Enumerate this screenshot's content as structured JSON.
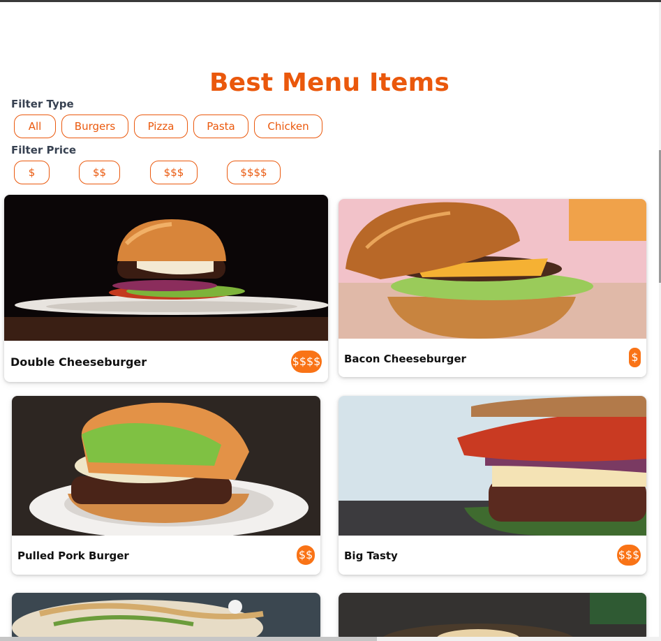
{
  "page": {
    "title": "Best Menu Items",
    "accent_color": "#ea580c",
    "badge_color": "#f97316"
  },
  "filters": {
    "type_label": "Filter Type",
    "type_options": [
      "All",
      "Burgers",
      "Pizza",
      "Pasta",
      "Chicken"
    ],
    "price_label": "Filter Price",
    "price_options": [
      "$",
      "$$",
      "$$$",
      "$$$$"
    ]
  },
  "items": [
    {
      "name": "Double Cheeseburger",
      "price": "$$$$",
      "image": "burger-on-plate-dark"
    },
    {
      "name": "Bacon Cheeseburger",
      "price": "$",
      "image": "cheeseburger-closeup"
    },
    {
      "name": "Pulled Pork Burger",
      "price": "$$",
      "image": "burger-with-lettuce"
    },
    {
      "name": "Big Tasty",
      "price": "$$$",
      "image": "burger-with-bacon-tomato"
    },
    {
      "name": "",
      "price": "",
      "image": "pasta-dish"
    },
    {
      "name": "",
      "price": "",
      "image": "dark-dish"
    }
  ]
}
